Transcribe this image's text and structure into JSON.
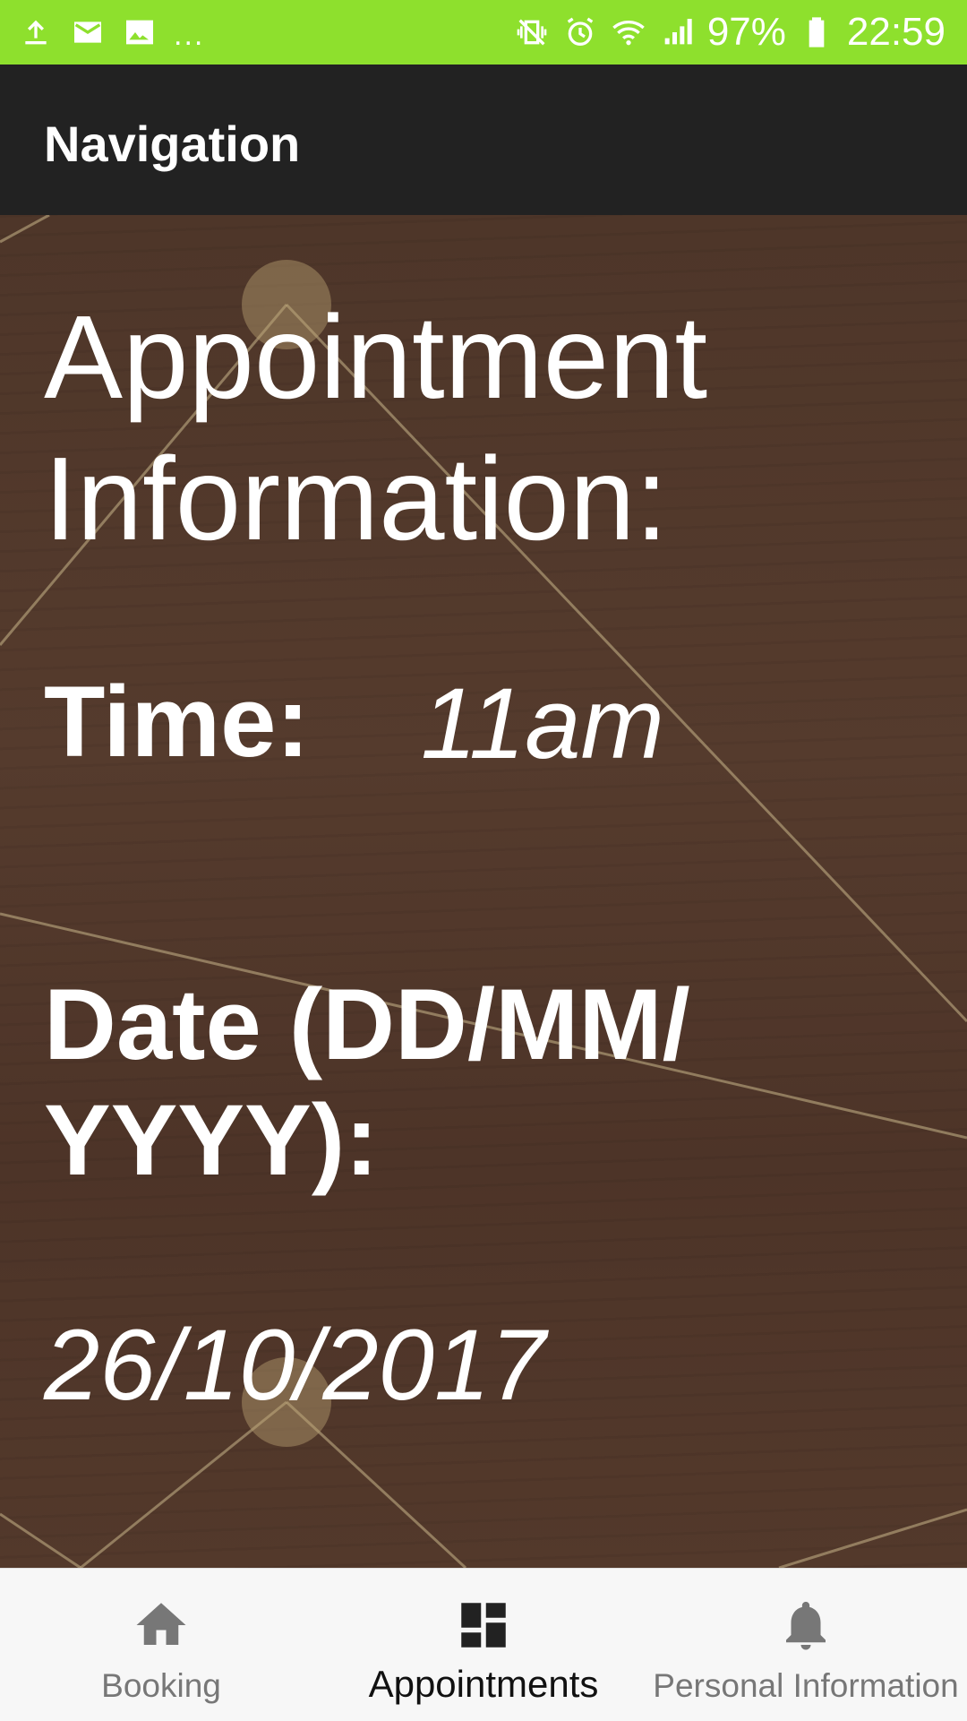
{
  "status_bar": {
    "left_icons": [
      "upload-icon",
      "mail-icon",
      "image-icon"
    ],
    "more": "...",
    "right_icons": [
      "vibrate-icon",
      "alarm-icon",
      "wifi-icon",
      "signal-icon"
    ],
    "battery_percent": "97%",
    "time": "22:59",
    "background_color": "#8ee02d"
  },
  "app_bar": {
    "title": "Navigation",
    "background_color": "#222222"
  },
  "main": {
    "heading_line1": "Appointment",
    "heading_line2": "Information:",
    "time_label": "Time:",
    "time_value": "11am",
    "date_label_line1": "Date (DD/MM/",
    "date_label_line2": "YYYY):",
    "date_value": "26/10/2017"
  },
  "bottom_nav": {
    "items": [
      {
        "label": "Booking",
        "icon": "home-icon",
        "active": false
      },
      {
        "label": "Appointments",
        "icon": "dashboard-icon",
        "active": true
      },
      {
        "label": "Personal Information",
        "icon": "bell-icon",
        "active": false
      }
    ]
  }
}
